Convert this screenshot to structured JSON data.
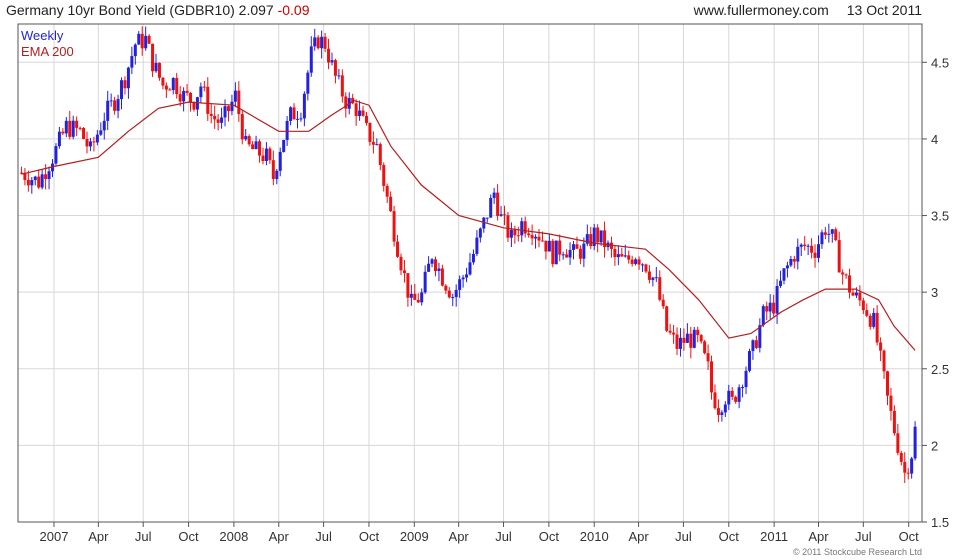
{
  "header": {
    "title": "Germany 10yr Bond Yield (GDBR10)",
    "last": "2.097",
    "change": "-0.09",
    "site": "www.fullermoney.com",
    "date": "13 Oct 2011"
  },
  "footer": {
    "copyright": "© 2011 Stockcube Research Ltd"
  },
  "colors": {
    "up": "#2222dd",
    "down": "#ee1111",
    "ema": "#b02020",
    "grid": "#d8d8d8",
    "frame": "#555555"
  },
  "chart_data": {
    "type": "line",
    "title": "Germany 10yr Bond Yield (GDBR10)",
    "subtitle": "Weekly",
    "legend": [
      "Weekly",
      "EMA 200"
    ],
    "legend_position": "top-left",
    "y_axis_position": "right",
    "grid": true,
    "ylim": [
      1.5,
      4.75
    ],
    "y_ticks": [
      "1.5",
      "2",
      "2.5",
      "3",
      "3.5",
      "4",
      "4.5"
    ],
    "x_ticks": [
      "2007",
      "Apr",
      "Jul",
      "Oct",
      "2008",
      "Apr",
      "Jul",
      "Oct",
      "2009",
      "Apr",
      "Jul",
      "Oct",
      "2010",
      "Apr",
      "Jul",
      "Oct",
      "2011",
      "Apr",
      "Jul",
      "Oct"
    ],
    "x_start": "2006-10-20",
    "x_end": "2011-10-28",
    "weekly_series": {
      "name": "Weekly",
      "points": [
        [
          "2006-10-27",
          3.78
        ],
        [
          "2006-12-01",
          3.72
        ],
        [
          "2007-01-01",
          3.9
        ],
        [
          "2007-01-26",
          4.08
        ],
        [
          "2007-02-23",
          4.05
        ],
        [
          "2007-03-16",
          3.92
        ],
        [
          "2007-04-13",
          4.15
        ],
        [
          "2007-05-04",
          4.25
        ],
        [
          "2007-05-25",
          4.4
        ],
        [
          "2007-06-15",
          4.62
        ],
        [
          "2007-07-06",
          4.65
        ],
        [
          "2007-07-20",
          4.5
        ],
        [
          "2007-08-10",
          4.35
        ],
        [
          "2007-08-31",
          4.38
        ],
        [
          "2007-09-21",
          4.28
        ],
        [
          "2007-10-12",
          4.25
        ],
        [
          "2007-10-26",
          4.35
        ],
        [
          "2007-11-16",
          4.15
        ],
        [
          "2007-12-07",
          4.1
        ],
        [
          "2008-01-04",
          4.28
        ],
        [
          "2008-01-25",
          3.95
        ],
        [
          "2008-02-15",
          3.92
        ],
        [
          "2008-03-07",
          3.88
        ],
        [
          "2008-03-21",
          3.75
        ],
        [
          "2008-04-04",
          3.95
        ],
        [
          "2008-04-25",
          4.15
        ],
        [
          "2008-05-16",
          4.2
        ],
        [
          "2008-06-06",
          4.55
        ],
        [
          "2008-06-20",
          4.65
        ],
        [
          "2008-07-04",
          4.62
        ],
        [
          "2008-07-25",
          4.4
        ],
        [
          "2008-08-15",
          4.25
        ],
        [
          "2008-09-05",
          4.2
        ],
        [
          "2008-09-26",
          4.05
        ],
        [
          "2008-10-17",
          3.95
        ],
        [
          "2008-10-31",
          3.72
        ],
        [
          "2008-11-21",
          3.4
        ],
        [
          "2008-12-12",
          3.1
        ],
        [
          "2008-12-26",
          2.92
        ],
        [
          "2009-01-16",
          2.98
        ],
        [
          "2009-02-06",
          3.25
        ],
        [
          "2009-02-27",
          3.1
        ],
        [
          "2009-03-20",
          2.98
        ],
        [
          "2009-04-10",
          3.1
        ],
        [
          "2009-05-01",
          3.25
        ],
        [
          "2009-05-22",
          3.45
        ],
        [
          "2009-06-12",
          3.65
        ],
        [
          "2009-06-26",
          3.48
        ],
        [
          "2009-07-17",
          3.35
        ],
        [
          "2009-08-07",
          3.45
        ],
        [
          "2009-08-28",
          3.42
        ],
        [
          "2009-09-18",
          3.35
        ],
        [
          "2009-10-09",
          3.25
        ],
        [
          "2009-10-30",
          3.3
        ],
        [
          "2009-11-20",
          3.25
        ],
        [
          "2009-12-11",
          3.28
        ],
        [
          "2010-01-01",
          3.38
        ],
        [
          "2010-01-22",
          3.32
        ],
        [
          "2010-02-12",
          3.22
        ],
        [
          "2010-03-05",
          3.2
        ],
        [
          "2010-03-26",
          3.25
        ],
        [
          "2010-04-16",
          3.18
        ],
        [
          "2010-05-07",
          3.05
        ],
        [
          "2010-05-28",
          2.75
        ],
        [
          "2010-06-18",
          2.65
        ],
        [
          "2010-07-09",
          2.7
        ],
        [
          "2010-07-30",
          2.68
        ],
        [
          "2010-08-20",
          2.5
        ],
        [
          "2010-08-27",
          2.35
        ],
        [
          "2010-09-10",
          2.25
        ],
        [
          "2010-09-24",
          2.32
        ],
        [
          "2010-10-08",
          2.28
        ],
        [
          "2010-10-29",
          2.45
        ],
        [
          "2010-11-19",
          2.62
        ],
        [
          "2010-12-10",
          2.85
        ],
        [
          "2011-01-01",
          2.92
        ],
        [
          "2011-01-21",
          3.12
        ],
        [
          "2011-02-11",
          3.25
        ],
        [
          "2011-03-04",
          3.3
        ],
        [
          "2011-03-25",
          3.28
        ],
        [
          "2011-04-15",
          3.42
        ],
        [
          "2011-04-29",
          3.35
        ],
        [
          "2011-05-20",
          3.12
        ],
        [
          "2011-06-10",
          2.98
        ],
        [
          "2011-07-01",
          2.92
        ],
        [
          "2011-07-22",
          2.8
        ],
        [
          "2011-08-05",
          2.55
        ],
        [
          "2011-08-19",
          2.3
        ],
        [
          "2011-09-02",
          2.1
        ],
        [
          "2011-09-23",
          1.82
        ],
        [
          "2011-10-07",
          1.95
        ],
        [
          "2011-10-14",
          2.1
        ]
      ]
    },
    "ema_series": {
      "name": "EMA 200",
      "points": [
        [
          "2006-10-27",
          3.77
        ],
        [
          "2007-01-01",
          3.82
        ],
        [
          "2007-04-01",
          3.88
        ],
        [
          "2007-06-01",
          4.05
        ],
        [
          "2007-08-01",
          4.2
        ],
        [
          "2007-10-01",
          4.24
        ],
        [
          "2008-01-01",
          4.22
        ],
        [
          "2008-04-01",
          4.05
        ],
        [
          "2008-06-01",
          4.05
        ],
        [
          "2008-07-15",
          4.15
        ],
        [
          "2008-09-01",
          4.25
        ],
        [
          "2008-10-01",
          4.22
        ],
        [
          "2008-11-15",
          3.95
        ],
        [
          "2009-01-15",
          3.7
        ],
        [
          "2009-04-01",
          3.5
        ],
        [
          "2009-07-01",
          3.42
        ],
        [
          "2009-10-01",
          3.38
        ],
        [
          "2010-01-01",
          3.32
        ],
        [
          "2010-04-15",
          3.28
        ],
        [
          "2010-06-01",
          3.15
        ],
        [
          "2010-08-01",
          2.95
        ],
        [
          "2010-10-01",
          2.7
        ],
        [
          "2010-11-15",
          2.73
        ],
        [
          "2011-01-15",
          2.87
        ],
        [
          "2011-03-01",
          2.95
        ],
        [
          "2011-04-15",
          3.02
        ],
        [
          "2011-06-15",
          3.02
        ],
        [
          "2011-08-01",
          2.95
        ],
        [
          "2011-09-01",
          2.78
        ],
        [
          "2011-10-14",
          2.62
        ]
      ]
    }
  }
}
